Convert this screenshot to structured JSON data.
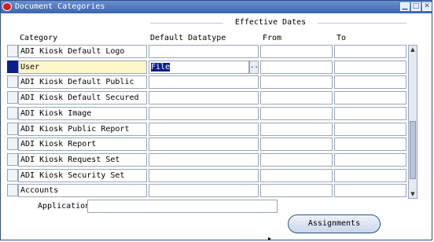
{
  "window": {
    "title": "Document Categories",
    "controls": [
      "minimize",
      "maximize",
      "close"
    ]
  },
  "group": {
    "effective_dates_label": "Effective Dates"
  },
  "columns": {
    "category": "Category",
    "datatype": "Default Datatype",
    "from": "From",
    "to": "To"
  },
  "rows": [
    {
      "category": "ADI Kiosk Default Logo",
      "datatype": "",
      "from": "",
      "to": ""
    },
    {
      "category": "User",
      "datatype": "File",
      "from": "",
      "to": ""
    },
    {
      "category": "ADI Kiosk Default Public",
      "datatype": "",
      "from": "",
      "to": ""
    },
    {
      "category": "ADI Kiosk Default Secured",
      "datatype": "",
      "from": "",
      "to": ""
    },
    {
      "category": "ADI Kiosk Image",
      "datatype": "",
      "from": "",
      "to": ""
    },
    {
      "category": "ADI Kiosk Public Report",
      "datatype": "",
      "from": "",
      "to": ""
    },
    {
      "category": "ADI Kiosk Report",
      "datatype": "",
      "from": "",
      "to": ""
    },
    {
      "category": "ADI Kiosk Request Set",
      "datatype": "",
      "from": "",
      "to": ""
    },
    {
      "category": "ADI Kiosk Security Set",
      "datatype": "",
      "from": "",
      "to": ""
    },
    {
      "category": "Accounts",
      "datatype": "",
      "from": "",
      "to": ""
    }
  ],
  "lov_button": {
    "label": "..."
  },
  "application": {
    "label": "Application",
    "value": ""
  },
  "buttons": {
    "assignments": "Assignments"
  },
  "colors": {
    "titlebar": "#3c64b0",
    "current_record": "#fff6c8",
    "selection": "#0c1f8c"
  },
  "icons": {
    "app_icon": "oracle-icon",
    "minimize": "minimize-icon",
    "maximize": "maximize-icon",
    "close": "close-icon"
  }
}
